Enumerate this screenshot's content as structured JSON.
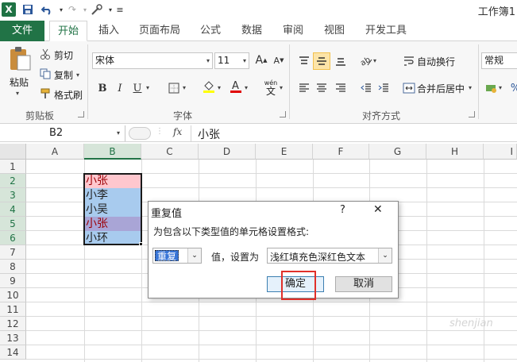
{
  "app": {
    "logo": "X",
    "workbook_title": "工作簿1"
  },
  "quick_access": {
    "icons": [
      "save-icon",
      "undo-icon",
      "redo-icon",
      "customize-icon"
    ]
  },
  "tabs": [
    {
      "label": "文件"
    },
    {
      "label": "开始"
    },
    {
      "label": "插入"
    },
    {
      "label": "页面布局"
    },
    {
      "label": "公式"
    },
    {
      "label": "数据"
    },
    {
      "label": "审阅"
    },
    {
      "label": "视图"
    },
    {
      "label": "开发工具"
    }
  ],
  "clipboard": {
    "paste": "粘贴",
    "cut": "剪切",
    "copy": "复制",
    "format_painter": "格式刷",
    "group": "剪贴板"
  },
  "font": {
    "name": "宋体",
    "size": "11",
    "grow": "A",
    "shrink": "A",
    "bold": "B",
    "italic": "I",
    "underline": "U",
    "phonetic": "wén",
    "group": "字体"
  },
  "alignment": {
    "wrap": "自动换行",
    "merge": "合并后居中",
    "group": "对齐方式"
  },
  "number": {
    "format": "常规"
  },
  "formula_bar": {
    "cell_ref": "B2",
    "fx": "fx",
    "content": "小张"
  },
  "columns": [
    "A",
    "B",
    "C",
    "D",
    "E",
    "F",
    "G",
    "H",
    "I"
  ],
  "rows": [
    "1",
    "2",
    "3",
    "4",
    "5",
    "6",
    "7",
    "8",
    "9",
    "10",
    "11",
    "12",
    "13",
    "14"
  ],
  "cells": {
    "b2": "小张",
    "b3": "小李",
    "b4": "小吴",
    "b5": "小张",
    "b6": "小环"
  },
  "colors": {
    "accent": "#217346",
    "dup_fill": "#ffc7ce",
    "dup_text": "#9c0006",
    "sel_fill": "#a8cbee",
    "sel_dup_fill": "#a9a5d6"
  },
  "dialog": {
    "title": "重复值",
    "help": "?",
    "close": "✕",
    "prompt": "为包含以下类型值的单元格设置格式:",
    "type_value": "重复",
    "mid_label": "值，设置为",
    "format_value": "浅红填充色深红色文本",
    "ok": "确定",
    "cancel": "取消"
  },
  "watermark": "shenjian"
}
